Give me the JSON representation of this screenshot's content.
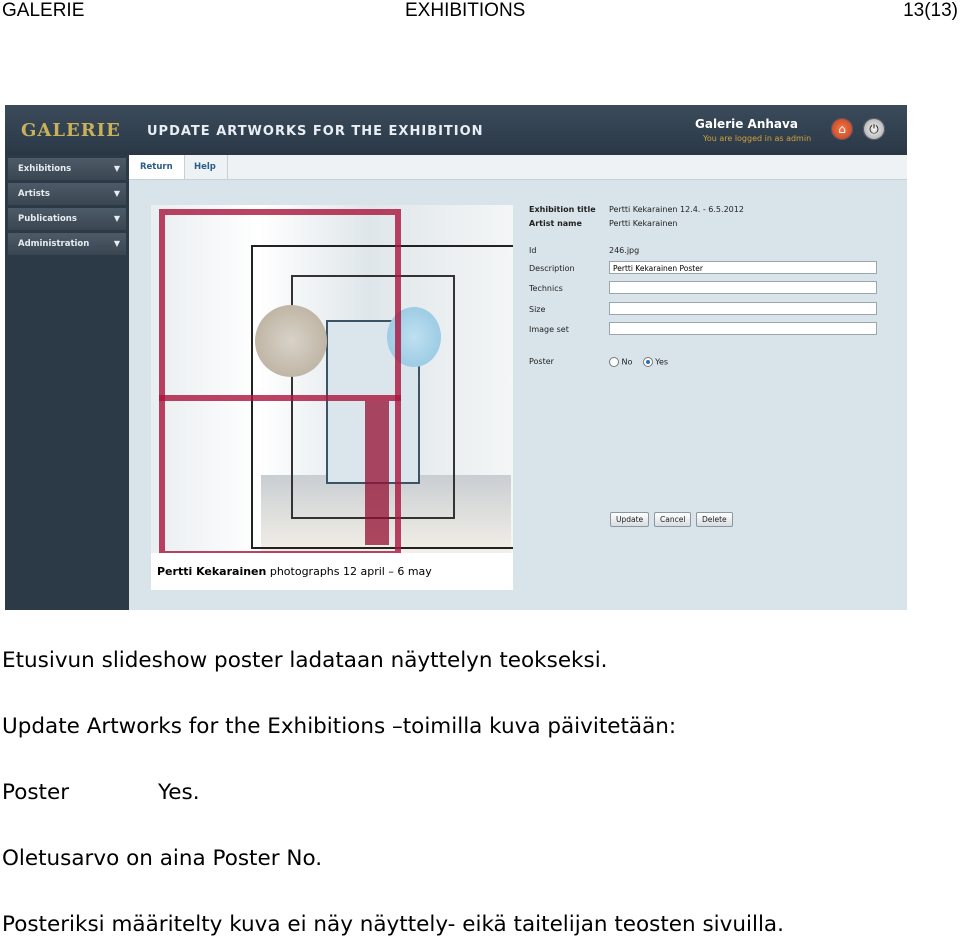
{
  "header": {
    "left": "GALERIE",
    "center": "EXHIBITIONS",
    "page": "13(13)"
  },
  "screenshot": {
    "logo": "GALERIE",
    "heading": "UPDATE ARTWORKS FOR THE EXHIBITION",
    "org": "Galerie Anhava",
    "login_status": "You are logged in as admin",
    "sidebar": [
      {
        "label": "Exhibitions"
      },
      {
        "label": "Artists"
      },
      {
        "label": "Publications"
      },
      {
        "label": "Administration"
      }
    ],
    "tabs": {
      "return": "Return",
      "help": "Help"
    },
    "poster_caption": {
      "artist": "Pertti Kekarainen",
      "rest": "photographs  12 april – 6 may"
    },
    "form": {
      "exhibition_title_label": "Exhibition title",
      "exhibition_title_value": "Pertti Kekarainen  12.4. - 6.5.2012",
      "artist_name_label": "Artist name",
      "artist_name_value": "Pertti Kekarainen",
      "id_label": "Id",
      "id_value": "246.jpg",
      "description_label": "Description",
      "description_value": "Pertti Kekarainen Poster",
      "technics_label": "Technics",
      "technics_value": "",
      "size_label": "Size",
      "size_value": "",
      "image_set_label": "Image set",
      "image_set_value": "",
      "poster_label": "Poster",
      "poster_no": "No",
      "poster_yes": "Yes",
      "poster_selected": "Yes",
      "update_button": "Update",
      "cancel_button": "Cancel",
      "delete_button": "Delete"
    }
  },
  "paragraphs": {
    "p1": "Etusivun slideshow poster ladataan näyttelyn teokseksi.",
    "p2": "Update Artworks for the Exhibitions –toimilla kuva päivitetään:",
    "p3_label": "Poster",
    "p3_value": "Yes.",
    "p4": "Oletusarvo on aina Poster No.",
    "p5": "Posteriksi määritelty kuva ei näy näyttely- eikä taitelijan teosten sivuilla."
  },
  "colors": {
    "topbar": "#2a3846",
    "sidebar": "#2c3a48",
    "content_bg": "#d9e4ea",
    "logo_gold": "#c9b15a",
    "poster_red": "#aa143c"
  }
}
